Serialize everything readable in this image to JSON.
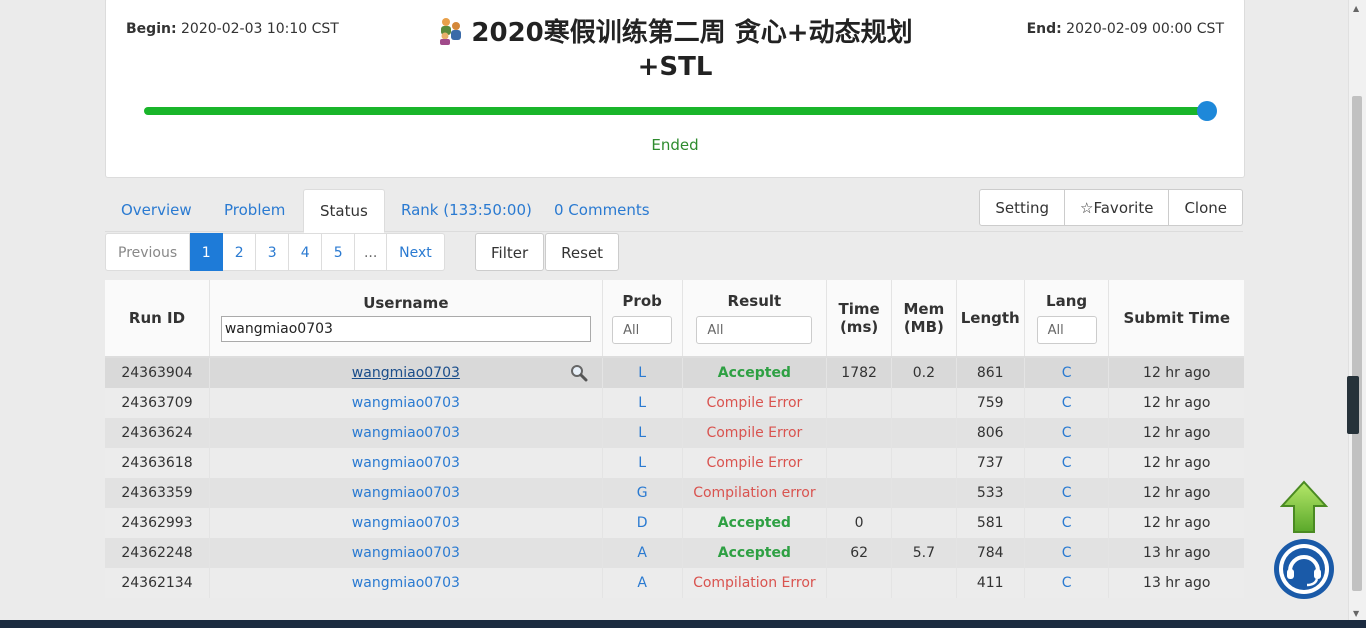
{
  "contest": {
    "begin_label": "Begin:",
    "begin_time": "2020-02-03 10:10 CST",
    "end_label": "End:",
    "end_time": "2020-02-09 00:00 CST",
    "title": "2020寒假训练第二周 贪心+动态规划+STL",
    "progress": 1.0,
    "status": "Ended"
  },
  "tabs": [
    {
      "label": "Overview"
    },
    {
      "label": "Problem"
    },
    {
      "label": "Status"
    },
    {
      "label": "Rank (133:50:00)"
    },
    {
      "label": "0 Comments"
    }
  ],
  "actions": {
    "setting": "Setting",
    "favorite": "☆Favorite",
    "clone": "Clone"
  },
  "pager": {
    "previous": "Previous",
    "pages": [
      "1",
      "2",
      "3",
      "4",
      "5"
    ],
    "ellipsis": "...",
    "next": "Next"
  },
  "filters": {
    "filter": "Filter",
    "reset": "Reset"
  },
  "table": {
    "headers": {
      "run_id": "Run ID",
      "username": "Username",
      "prob": "Prob",
      "result": "Result",
      "time": "Time (ms)",
      "mem": "Mem (MB)",
      "length": "Length",
      "lang": "Lang",
      "submit_time": "Submit Time"
    },
    "username_filter": "wangmiao0703",
    "prob_filter": "All",
    "result_filter": "All",
    "lang_filter": "All",
    "rows": [
      {
        "run_id": "24363904",
        "user": "wangmiao0703",
        "prob": "L",
        "result": "Accepted",
        "time": "1782",
        "mem": "0.2",
        "length": "861",
        "lang": "C",
        "submit": "12 hr ago"
      },
      {
        "run_id": "24363709",
        "user": "wangmiao0703",
        "prob": "L",
        "result": "Compile Error",
        "time": "",
        "mem": "",
        "length": "759",
        "lang": "C",
        "submit": "12 hr ago"
      },
      {
        "run_id": "24363624",
        "user": "wangmiao0703",
        "prob": "L",
        "result": "Compile Error",
        "time": "",
        "mem": "",
        "length": "806",
        "lang": "C",
        "submit": "12 hr ago"
      },
      {
        "run_id": "24363618",
        "user": "wangmiao0703",
        "prob": "L",
        "result": "Compile Error",
        "time": "",
        "mem": "",
        "length": "737",
        "lang": "C",
        "submit": "12 hr ago"
      },
      {
        "run_id": "24363359",
        "user": "wangmiao0703",
        "prob": "G",
        "result": "Compilation error",
        "time": "",
        "mem": "",
        "length": "533",
        "lang": "C",
        "submit": "12 hr ago"
      },
      {
        "run_id": "24362993",
        "user": "wangmiao0703",
        "prob": "D",
        "result": "Accepted",
        "time": "0",
        "mem": "",
        "length": "581",
        "lang": "C",
        "submit": "12 hr ago"
      },
      {
        "run_id": "24362248",
        "user": "wangmiao0703",
        "prob": "A",
        "result": "Accepted",
        "time": "62",
        "mem": "5.7",
        "length": "784",
        "lang": "C",
        "submit": "13 hr ago"
      },
      {
        "run_id": "24362134",
        "user": "wangmiao0703",
        "prob": "A",
        "result": "Compilation Error",
        "time": "",
        "mem": "",
        "length": "411",
        "lang": "C",
        "submit": "13 hr ago"
      }
    ]
  },
  "colors": {
    "link": "#2a7ad1",
    "accepted": "#2ea043",
    "error": "#d9534f",
    "progress": "#19b52a",
    "knob": "#1e88d9"
  },
  "icons": {
    "title": "users-group-icon",
    "search": "magnifier-icon",
    "scroll_top": "up-arrow-icon",
    "chat": "headset-chat-icon"
  }
}
